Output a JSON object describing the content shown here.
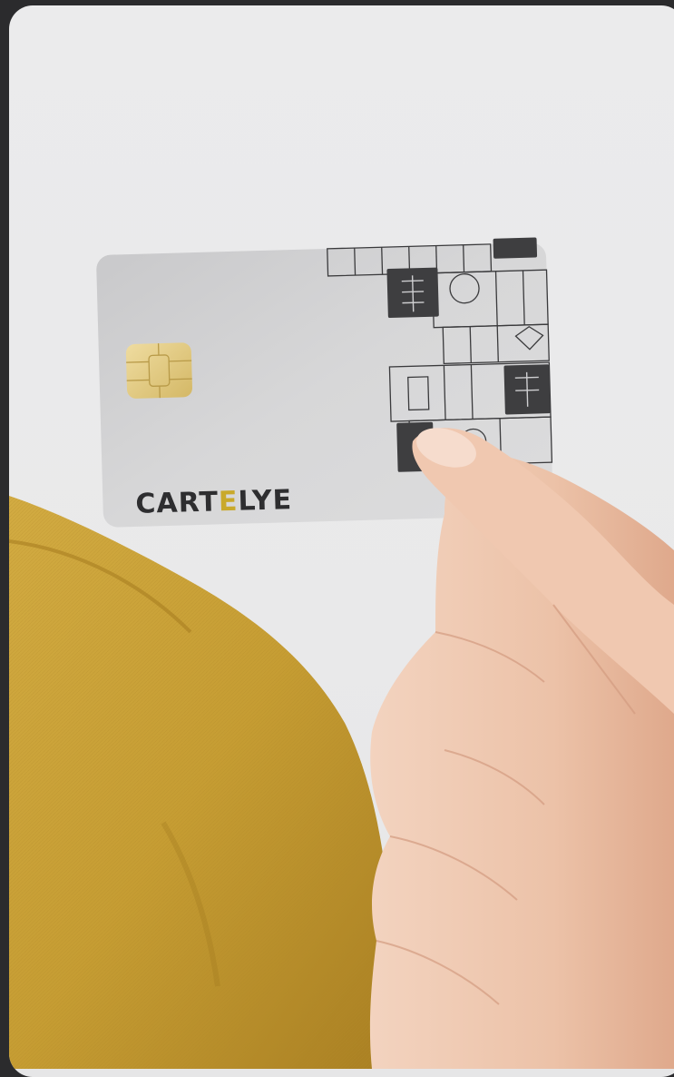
{
  "card": {
    "brand_prefix": "CART",
    "brand_accent_letter": "E",
    "brand_suffix": "LYE"
  },
  "colors": {
    "background": "#ebebec",
    "card": "#d4d4d5",
    "brand_text": "#2e2e30",
    "brand_accent": "#c9a92b",
    "shirt": "#c9a23a",
    "skin": "#f0c9b1",
    "chip": "#e6cf88"
  },
  "icons": {
    "chip": "emv-chip-icon"
  }
}
